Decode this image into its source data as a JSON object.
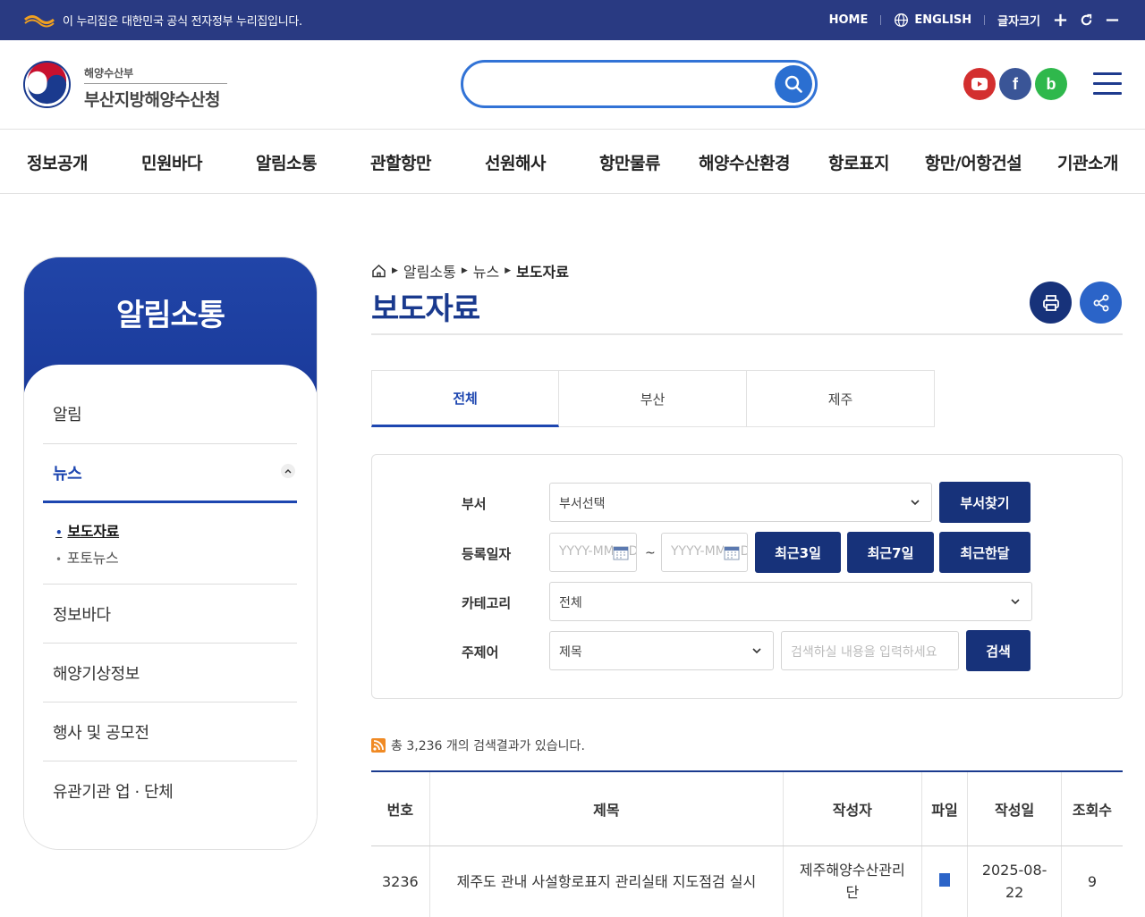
{
  "govbar": {
    "notice": "이 누리집은 대한민국 공식 전자정부 누리집입니다.",
    "home": "HOME",
    "english": "ENGLISH",
    "font_size": "글자크기"
  },
  "header": {
    "ministry": "해양수산부",
    "agency": "부산지방해양수산청",
    "search_placeholder": "",
    "social": [
      {
        "name": "youtube-icon",
        "glyph": "▶"
      },
      {
        "name": "facebook-icon",
        "glyph": "f"
      },
      {
        "name": "blog-icon",
        "glyph": "b"
      }
    ]
  },
  "gnb": [
    "정보공개",
    "민원바다",
    "알림소통",
    "관할항만",
    "선원해사",
    "항만물류",
    "해양수산환경",
    "항로표지",
    "항만/어항건설",
    "기관소개"
  ],
  "lnb": {
    "title": "알림소통",
    "items": [
      "알림",
      "뉴스",
      "정보바다",
      "해양기상정보",
      "행사 및 공모전",
      "유관기관 업 · 단체"
    ],
    "sub_items": [
      "보도자료",
      "포토뉴스"
    ]
  },
  "content": {
    "breadcrumb": [
      "알림소통",
      "뉴스",
      "보도자료"
    ],
    "title": "보도자료",
    "tabs": [
      "전체",
      "부산",
      "제주"
    ],
    "filter": {
      "dept_label": "부서",
      "dept_value": "부서선택",
      "dept_button": "부서찾기",
      "date_label": "등록일자",
      "date_placeholder": "YYYY-MM-DD",
      "tilde": "~",
      "recent_buttons": [
        "최근3일",
        "최근7일",
        "최근한달"
      ],
      "category_label": "카테고리",
      "category_value": "전체",
      "keyword_label": "주제어",
      "keyword_field": "제목",
      "keyword_placeholder": "검색하실 내용을 입력하세요",
      "search_button": "검색"
    },
    "result_text": "총 3,236 개의 검색결과가 있습니다.",
    "table": {
      "headers": [
        "번호",
        "제목",
        "작성자",
        "파일",
        "작성일",
        "조회수"
      ],
      "rows": [
        {
          "no": "3236",
          "title": "제주도 관내 사설항로표지 관리실태 지도점검 실시",
          "writer": "제주해양수산관리단",
          "date": "2025-08-22",
          "views": "9"
        }
      ]
    }
  },
  "colors": {
    "govbar": "#293a82",
    "primary": "#17327a",
    "accent": "#1d46b0",
    "search_border": "#3273d6"
  }
}
